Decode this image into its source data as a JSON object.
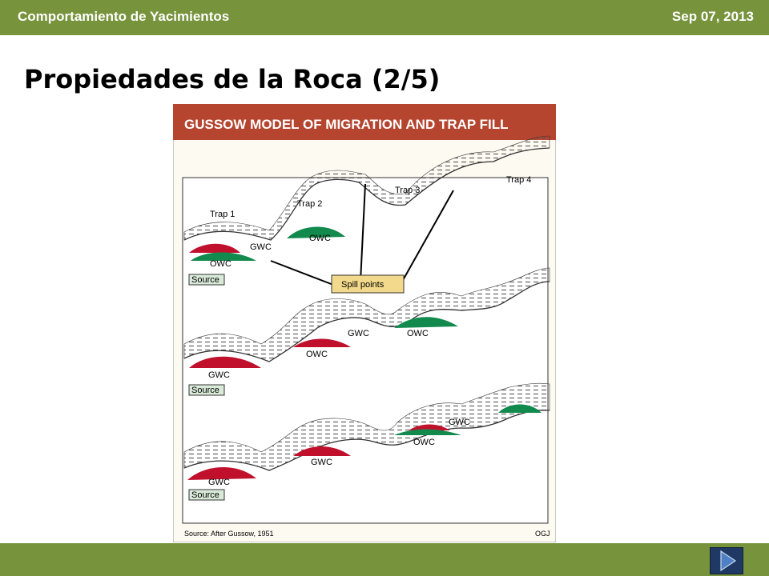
{
  "header": {
    "course_title": "Comportamiento de Yacimientos",
    "date": "Sep 07, 2013"
  },
  "slide": {
    "title": "Propiedades de la Roca (2/5)"
  },
  "figure": {
    "title": "GUSSOW MODEL OF MIGRATION AND TRAP FILL",
    "source": "Source: After Gussow, 1951",
    "credit": "OGJ",
    "labels": {
      "trap1": "Trap 1",
      "trap2": "Trap 2",
      "trap3": "Trap 3",
      "trap4": "Trap 4",
      "spill_points": "Spill points",
      "source": "Source",
      "owc": "OWC",
      "gwc": "GWC"
    },
    "colors": {
      "title_band": "#b5452f",
      "gas": "#c0102c",
      "oil": "#128a4e",
      "callout": "#f2d98b",
      "source_box": "#d9ead9"
    }
  },
  "navigation": {
    "next_icon": "play-next-icon"
  }
}
